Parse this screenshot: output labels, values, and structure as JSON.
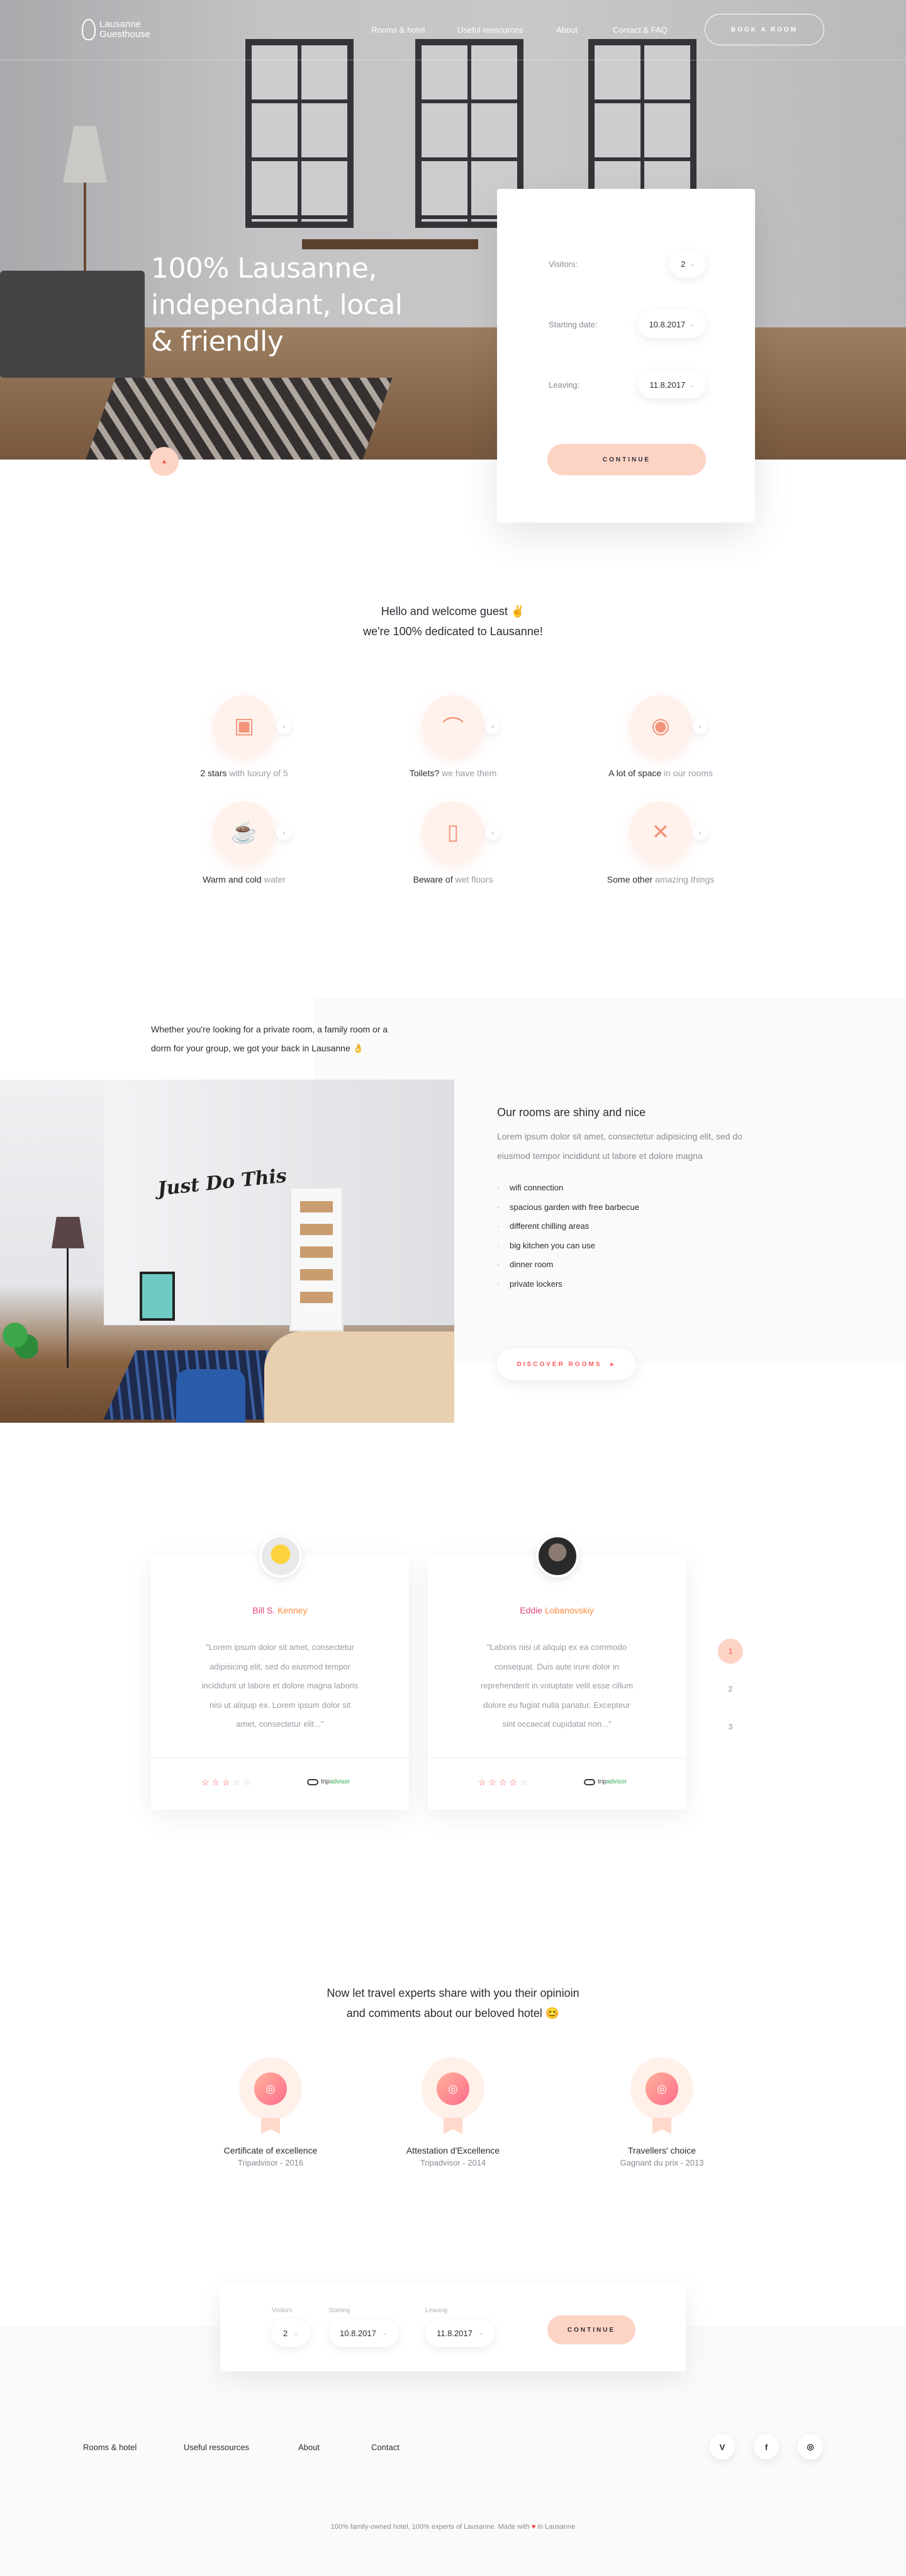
{
  "nav": {
    "logo_line1": "Lausanne",
    "logo_line2": "Guesthouse",
    "links": [
      "Rooms & hotel",
      "Useful ressources",
      "About",
      "Contact & FAQ"
    ],
    "book_label": "BOOK A ROOM"
  },
  "hero": {
    "title": "100% Lausanne, independant, local & friendly",
    "down_icon": "chevron-down-icon"
  },
  "booking": {
    "visitors_label": "Visitors:",
    "visitors_value": "2",
    "start_label": "Starting date:",
    "start_value": "10.8.2017",
    "leave_label": "Leaving:",
    "leave_value": "11.8.2017",
    "continue_label": "CONTINUE"
  },
  "welcome": {
    "line1": "Hello and welcome guest ✌",
    "line2": "we're 100% dedicated to Lausanne!"
  },
  "features": [
    {
      "icon": "picture-icon",
      "glyph": "▣",
      "strong": "2 stars",
      "light": " with luxury of 5"
    },
    {
      "icon": "hanger-icon",
      "glyph": "⌒",
      "strong": "Toilets?",
      "light": " we have them"
    },
    {
      "icon": "cookie-icon",
      "glyph": "◉",
      "strong": "A lot of space",
      "light": " in our rooms"
    },
    {
      "icon": "coffee-cup-icon",
      "glyph": "☕",
      "strong": "Warm and cold",
      "light": " water"
    },
    {
      "icon": "door-icon",
      "glyph": "▯",
      "strong": "Beware of",
      "light": " wet floors"
    },
    {
      "icon": "cutlery-icon",
      "glyph": "✕",
      "strong": "Some other",
      "light": " amazing things"
    }
  ],
  "rooms": {
    "intro": "Whether you're looking for a private room, a family room or a dorm for your group, we got your back in Lausanne 👌",
    "title": "Our rooms are shiny and nice",
    "desc": "Lorem ipsum dolor sit amet, consectetur adipisicing elit, sed do eiusmod tempor incididunt ut labore et dolore magna",
    "items": [
      "wifi connection",
      "spacious garden with free barbecue",
      "different chilling areas",
      "big kitchen you can use",
      "dinner room",
      "private lockers"
    ],
    "discover_label": "DISCOVER ROOMS",
    "photo_lettering": "Just Do This"
  },
  "testimonials": [
    {
      "first": "Bill S. ",
      "last": "Kenney",
      "quote": "\"Lorem ipsum dolor sit amet, consectetur adipisicing elit, sed do eiusmod tempor incididunt ut labore et dolore magna laboris nisi ut aliquip ex. Lorem ipsum dolor sit amet, consectetur elit...\"",
      "rating": 3,
      "source_a": "trip",
      "source_b": "advisor"
    },
    {
      "first": "Eddie ",
      "last": "Lobanovskiy",
      "quote": "\"Laboris nisi ut aliquip ex ea commodo consequat. Duis aute irure dolor in reprehenderit in voluptate velit esse cillum dolore eu fugiat nulla pariatur. Excepteur sint occaecat cupidatat non...\"",
      "rating": 4,
      "source_a": "trip",
      "source_b": "advisor"
    }
  ],
  "pager": [
    "1",
    "2",
    "3"
  ],
  "awards": {
    "title_line1": "Now let travel experts share with you their opinioin",
    "title_line2": "and comments about our beloved hotel 😊",
    "items": [
      {
        "title": "Certificate of excellence",
        "sub": "Tripadvisor - 2016"
      },
      {
        "title": "Attestation d'Excellence",
        "sub": "Tripadvisor - 2014"
      },
      {
        "title": "Travellers' choice",
        "sub": "Gagnant du prix - 2013"
      }
    ]
  },
  "mini_booking": {
    "visitors_label": "Visitors",
    "visitors_value": "2",
    "start_label": "Starting",
    "start_value": "10.8.2017",
    "leave_label": "Leaving",
    "leave_value": "11.8.2017",
    "continue_label": "CONTINUE"
  },
  "footer": {
    "links": [
      "Rooms & hotel",
      "Useful ressources",
      "About",
      "Contact"
    ],
    "social": [
      "V",
      "f",
      "◎"
    ],
    "copy_before": "100% family-owned hotel, 100% experts of Lausanne. Made with ",
    "copy_after": " in Lausanne"
  },
  "colors": {
    "accent": "#fdd3c4",
    "accent_text": "#ff4f4f",
    "name_gradient": "#ff8a3c"
  }
}
